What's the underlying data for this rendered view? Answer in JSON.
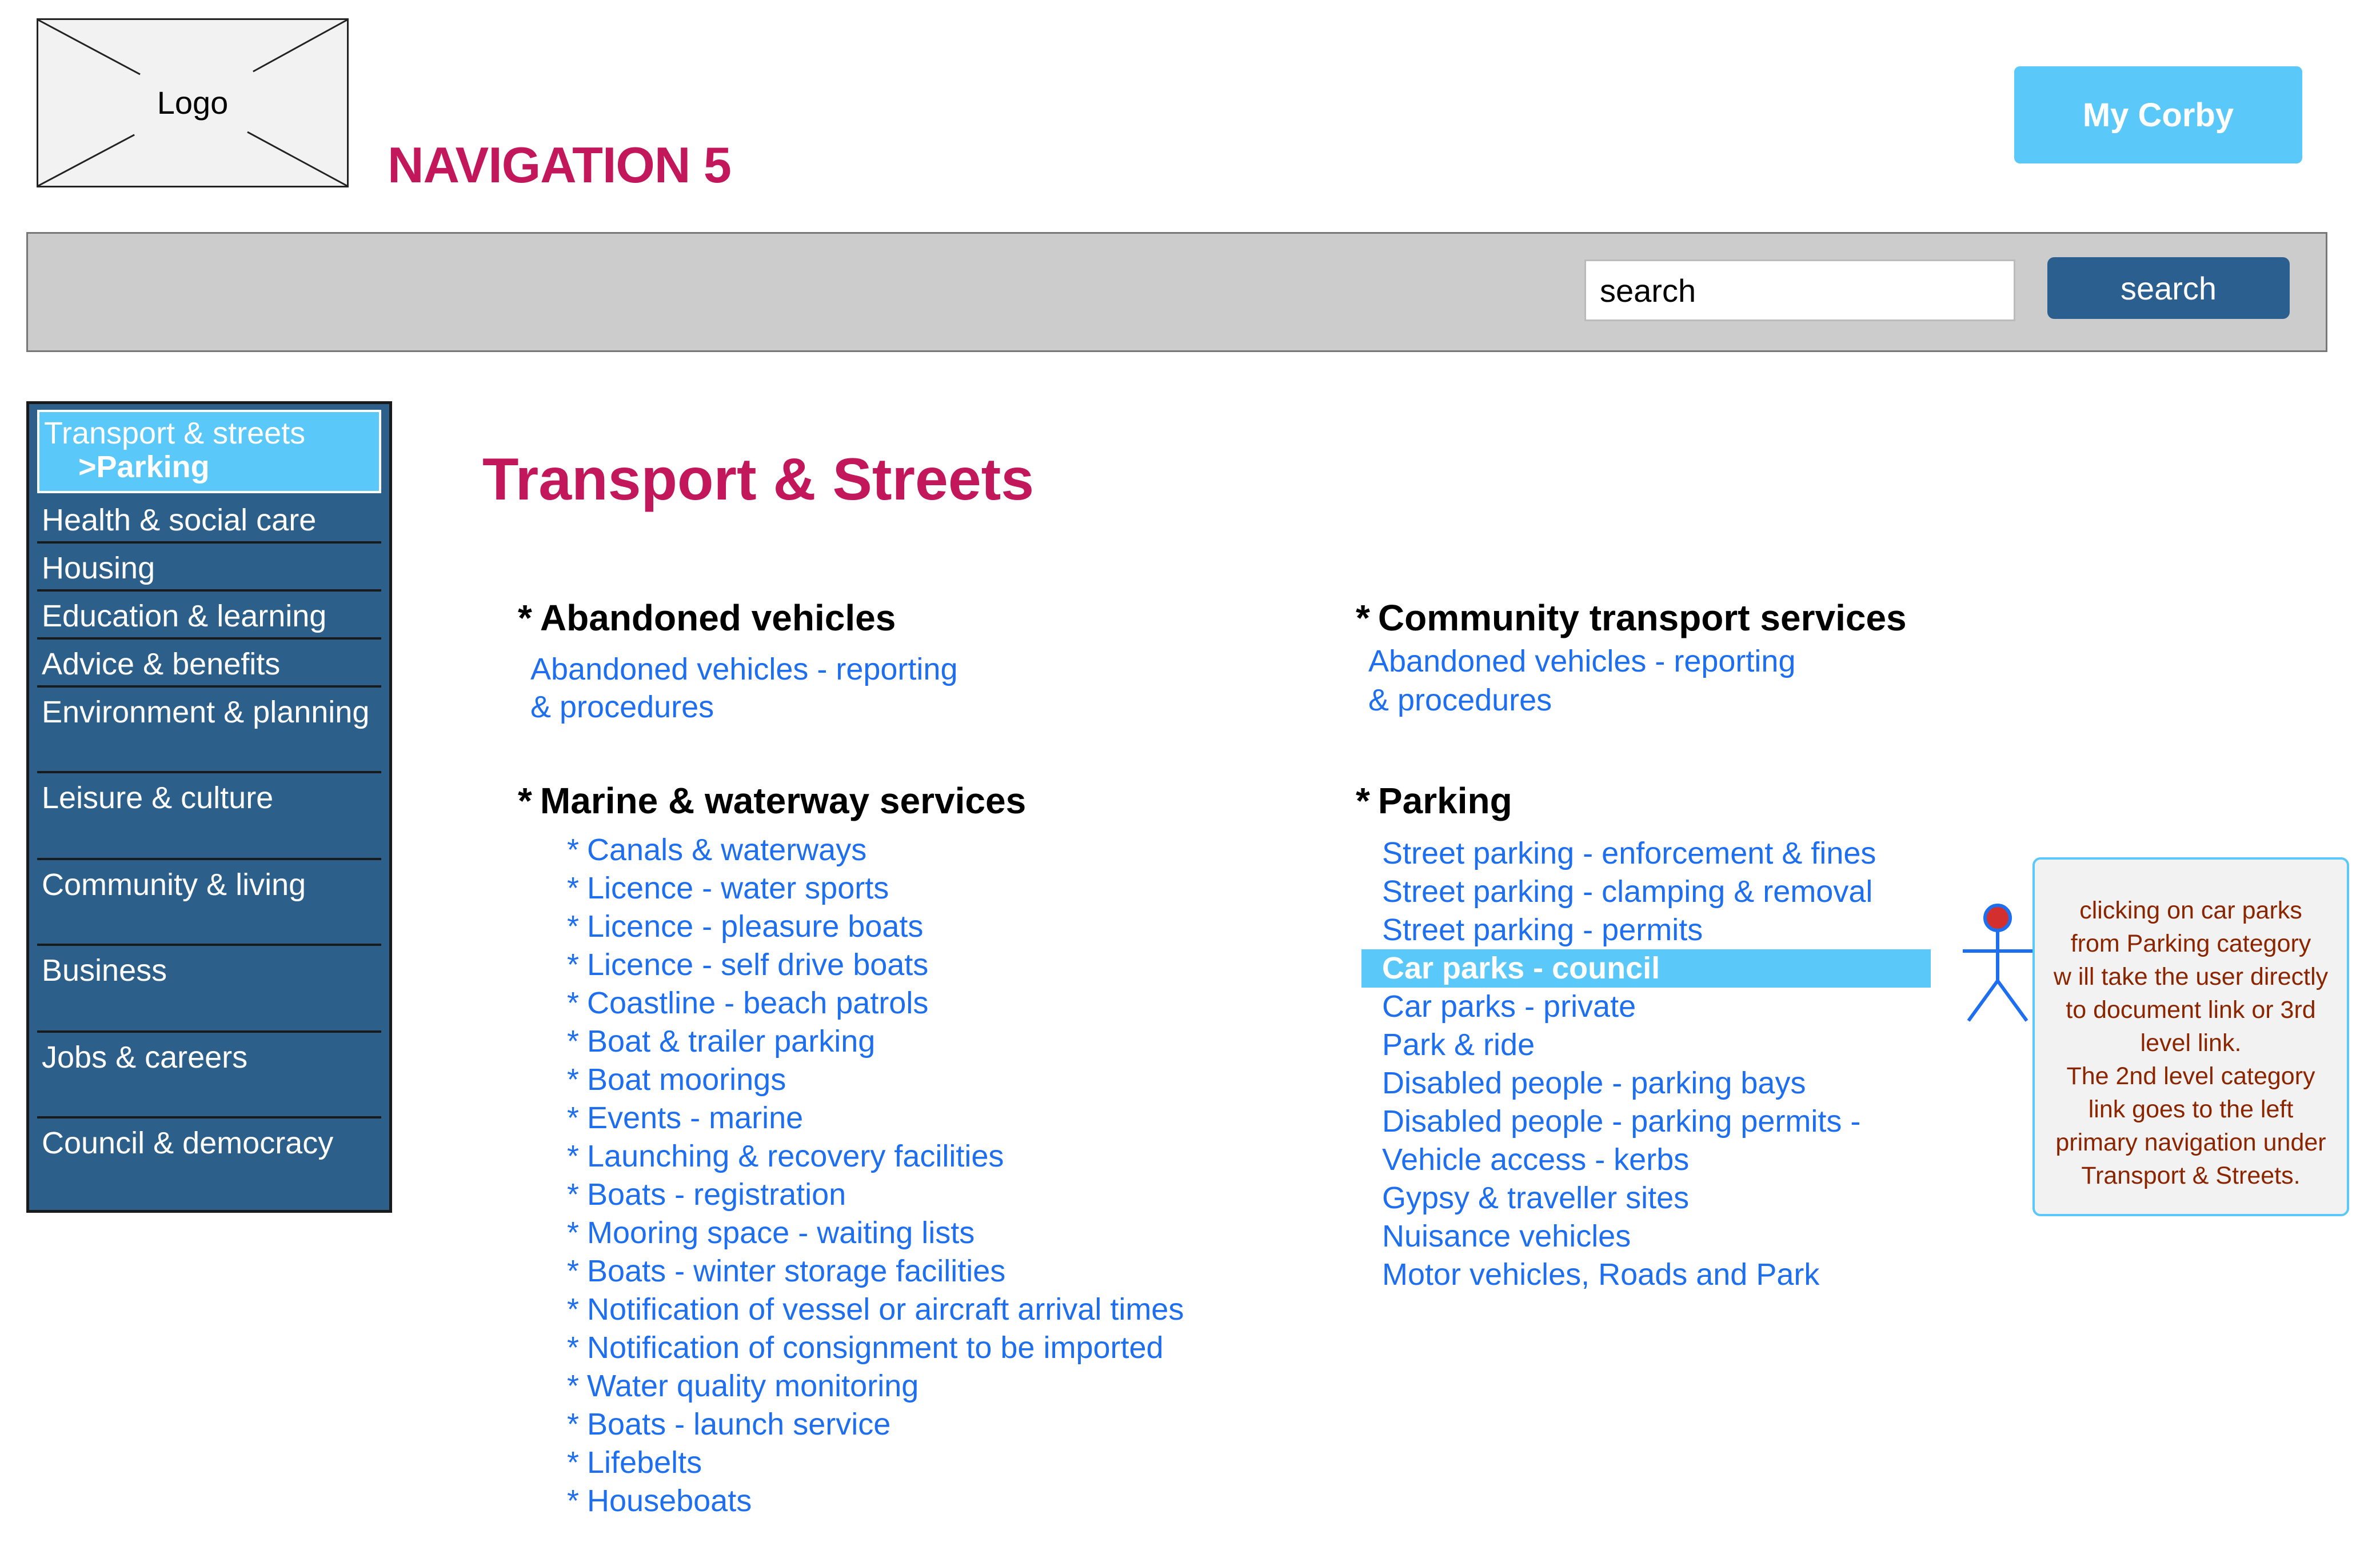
{
  "header": {
    "logo_label": "Logo",
    "page_title": "NAVIGATION 5",
    "my_corby_label": "My Corby"
  },
  "search": {
    "value": "search",
    "button_label": "search"
  },
  "sidebar": {
    "active": {
      "label": "Transport & streets",
      "sub_label": ">Parking"
    },
    "items": [
      "Health & social care",
      "Housing",
      "Education & learning",
      "Advice & benefits",
      "Environment & planning",
      "Leisure & culture",
      "Community & living",
      "Business",
      "Jobs & careers",
      "Council & democracy"
    ]
  },
  "content": {
    "title": "Transport & Streets",
    "bullet": "*",
    "abandoned": {
      "title": "Abandoned vehicles",
      "link_line1": "Abandoned vehicles - reporting",
      "link_line2": "& procedures"
    },
    "community": {
      "title": "Community transport services",
      "link_line1": "Abandoned vehicles - reporting",
      "link_line2": "& procedures"
    },
    "marine": {
      "title": "Marine & waterway services",
      "links": [
        "Canals & waterways",
        "Licence - water sports",
        "Licence - pleasure boats",
        "Licence - self drive boats",
        "Coastline - beach patrols",
        "Boat & trailer parking",
        "Boat moorings",
        "Events - marine",
        "Launching & recovery facilities",
        "Boats - registration",
        "Mooring space - waiting lists",
        "Boats - winter storage facilities",
        "Notification of vessel or aircraft arrival times",
        "Notification of consignment to be imported",
        "Water quality monitoring",
        "Boats - launch service",
        "Lifebelts",
        "Houseboats"
      ]
    },
    "parking": {
      "title": "Parking",
      "highlighted_index": 3,
      "links": [
        "Street parking - enforcement & fines",
        "Street parking - clamping & removal",
        "Street parking - permits",
        "Car parks - council",
        "Car parks - private",
        "Park & ride",
        "Disabled people - parking bays",
        "Disabled people - parking permits -",
        "Vehicle access - kerbs",
        "Gypsy & traveller sites",
        "Nuisance vehicles",
        "Motor vehicles, Roads and Park"
      ]
    }
  },
  "annotation": {
    "lines": [
      "clicking on car parks",
      "from Parking category",
      "w ill take the user directly",
      "to document link or 3rd",
      "level link.",
      "The 2nd level category",
      "link goes to the left",
      "primary navigation under",
      "Transport & Streets."
    ]
  },
  "colors": {
    "accent_title": "#c2185b",
    "nav_bg": "#2c5f8a",
    "nav_active": "#5bc8fa",
    "link": "#1e6ef0",
    "button_dark": "#2b5f8f",
    "button_light": "#5bc8fa",
    "note_text": "#8b2500"
  }
}
